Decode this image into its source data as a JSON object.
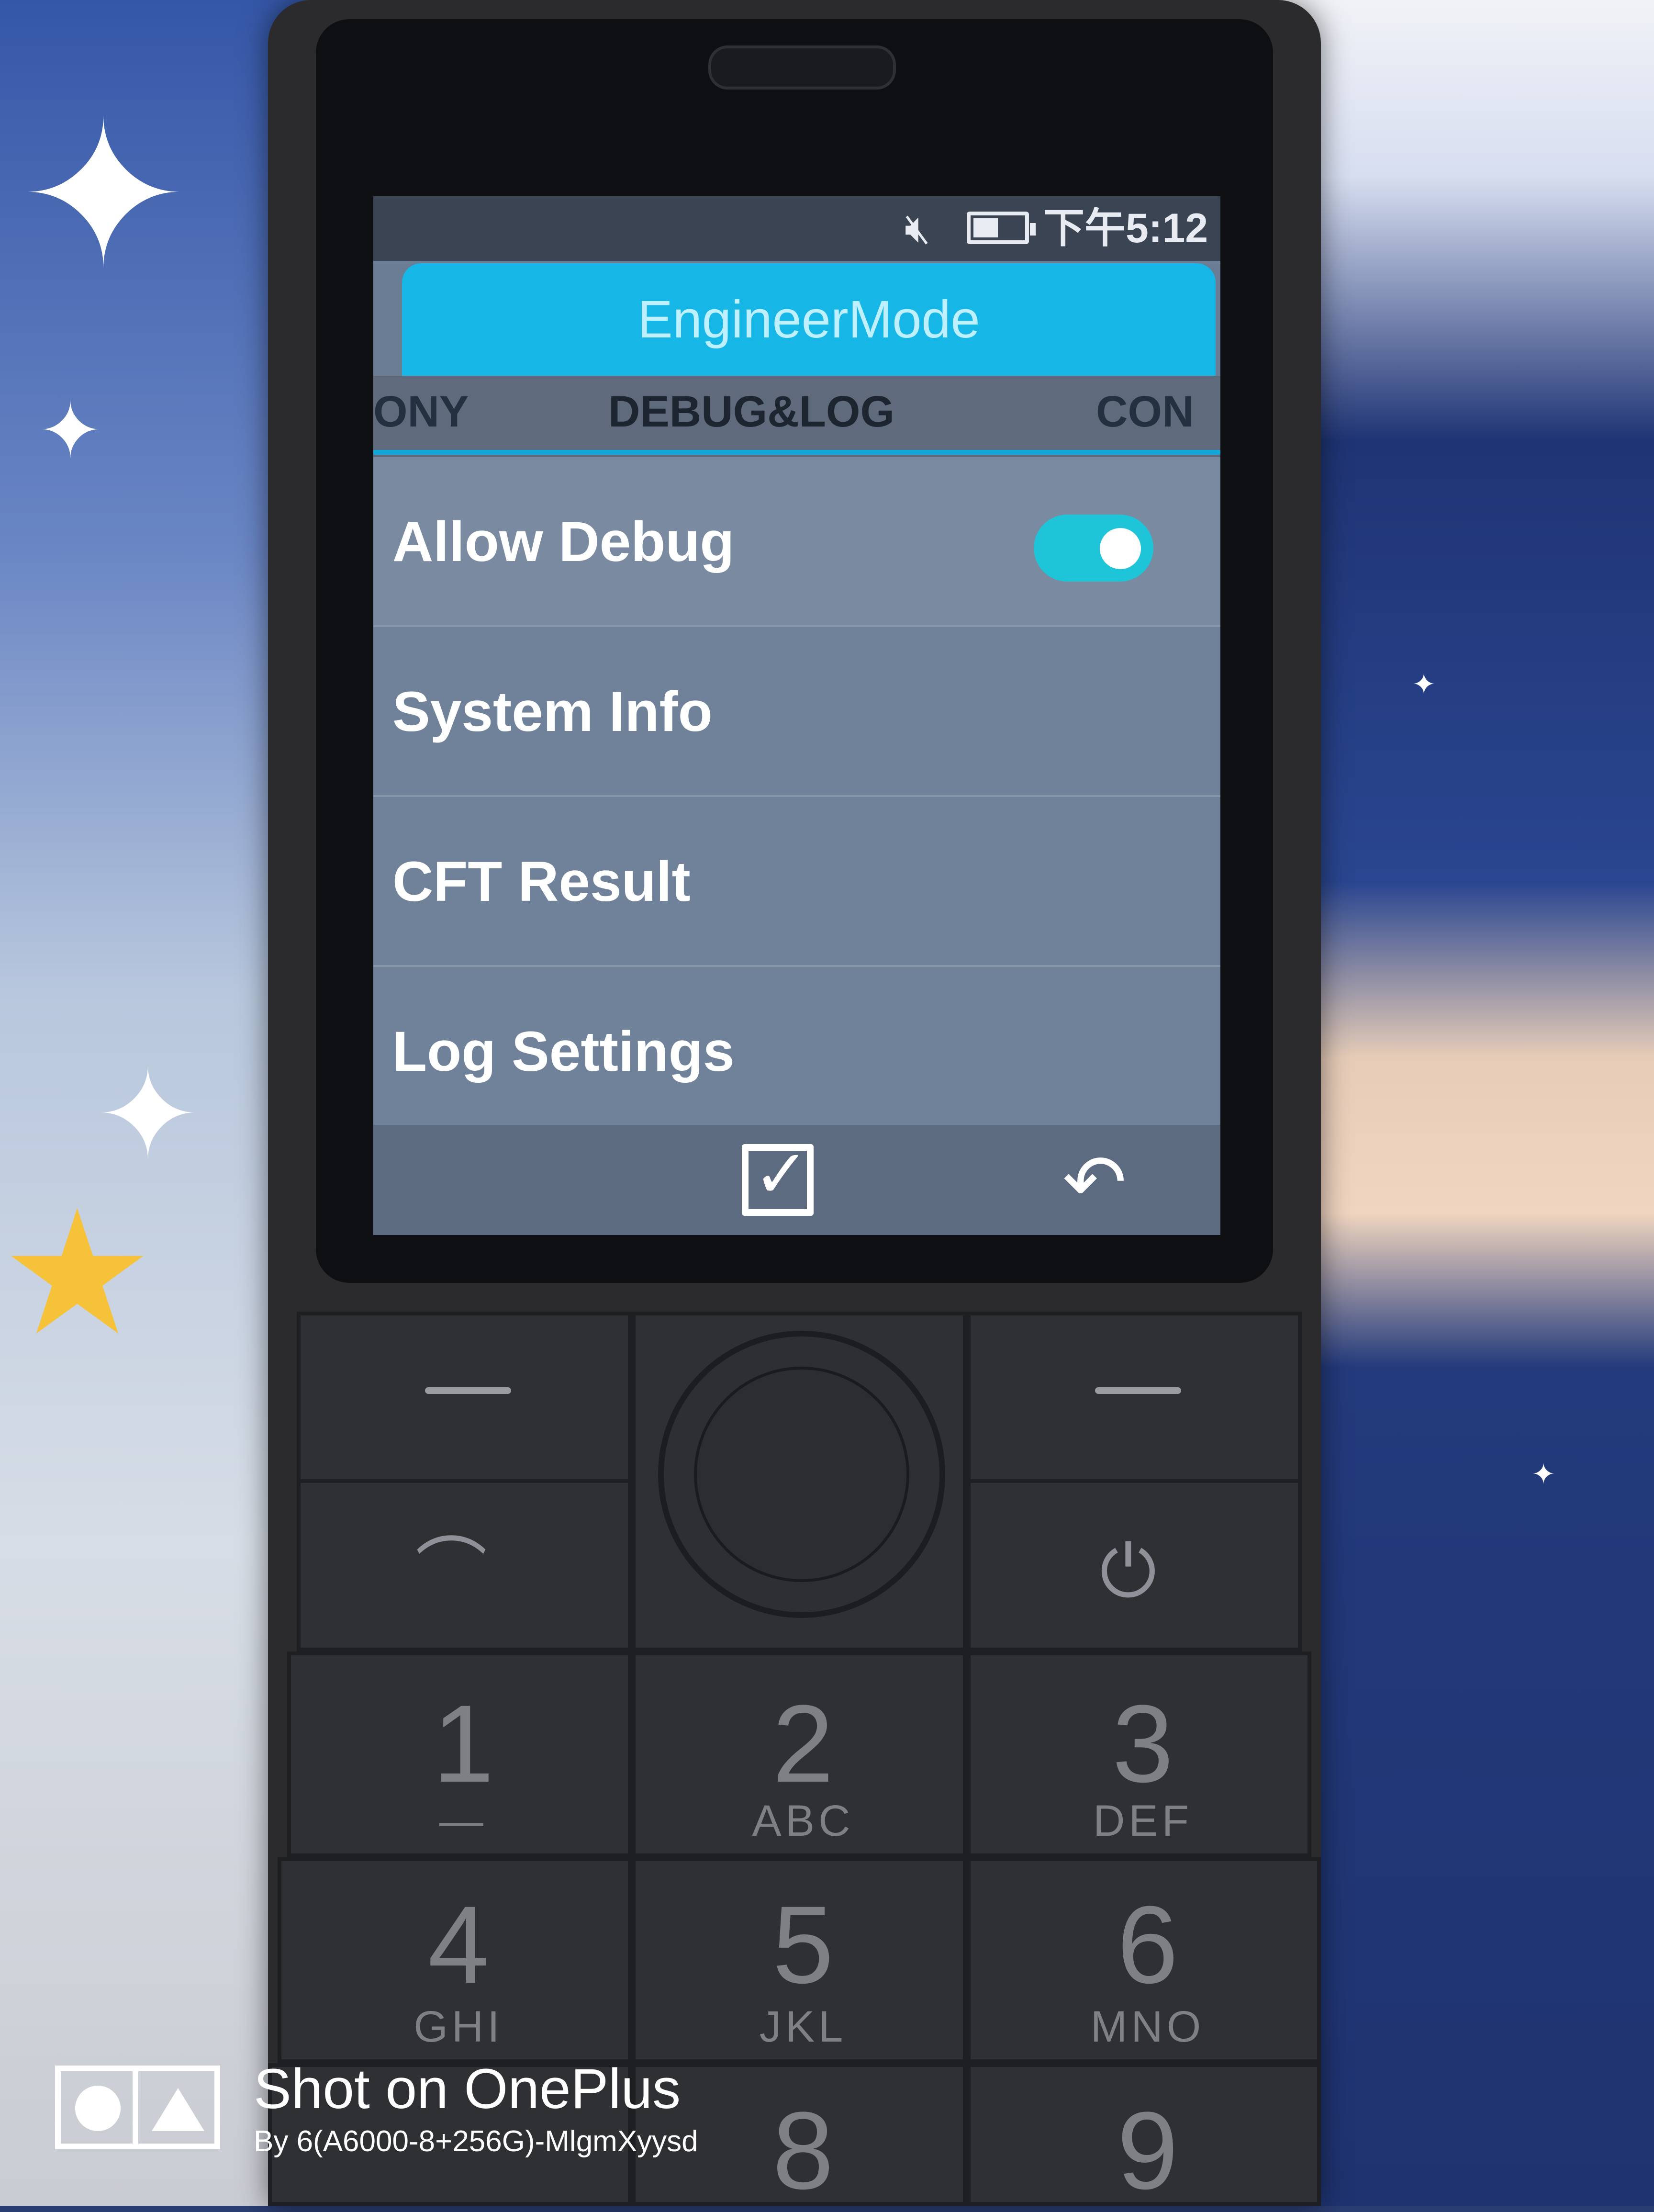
{
  "status_bar": {
    "mute_icon": "muted-speaker-icon",
    "battery_level": 0.5,
    "clock": "下午5:12"
  },
  "app": {
    "title": "EngineerMode",
    "accent_color": "#16b6e6"
  },
  "tabs": [
    {
      "label": "ONY",
      "selected": false
    },
    {
      "label": "DEBUG&LOG",
      "selected": true
    },
    {
      "label": "CON",
      "selected": false
    }
  ],
  "list": [
    {
      "label": "Allow Debug",
      "toggle_on": true
    },
    {
      "label": "System Info"
    },
    {
      "label": "CFT Result"
    },
    {
      "label": "Log Settings"
    }
  ],
  "softkeys": {
    "center_icon": "checkbox-checked-icon",
    "right_icon": "back-arrow-icon"
  },
  "keypad": {
    "keys": [
      {
        "digit": "1",
        "letters": "—"
      },
      {
        "digit": "2",
        "letters": "ABC"
      },
      {
        "digit": "3",
        "letters": "DEF"
      },
      {
        "digit": "4",
        "letters": "GHI"
      },
      {
        "digit": "5",
        "letters": "JKL"
      },
      {
        "digit": "6",
        "letters": "MNO"
      },
      {
        "digit": "8",
        "letters": ""
      },
      {
        "digit": "9",
        "letters": ""
      }
    ]
  },
  "watermark": {
    "title": "Shot on OnePlus",
    "subtitle": "By 6(A6000-8+256G)-MlgmXyysd"
  }
}
